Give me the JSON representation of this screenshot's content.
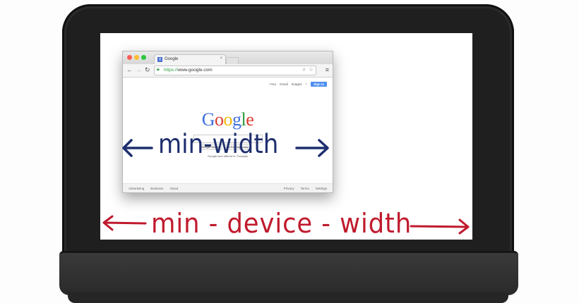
{
  "browser": {
    "tab_favicon": "g",
    "tab_title": "Google",
    "tab_close": "×",
    "url_secure": "https://",
    "url_rest": "www.google.com",
    "google_topbar": [
      "+You",
      "Gmail",
      "Images"
    ],
    "apps_icon": "apps-grid-icon",
    "sign_in": "Sign in",
    "logo_letters": [
      {
        "char": "G",
        "color": "#3c6fe0"
      },
      {
        "char": "o",
        "color": "#d93b2d"
      },
      {
        "char": "o",
        "color": "#f2b90f"
      },
      {
        "char": "g",
        "color": "#3c6fe0"
      },
      {
        "char": "l",
        "color": "#2b9c3e"
      },
      {
        "char": "e",
        "color": "#d93b2d"
      }
    ],
    "search_buttons": [
      "Google Search",
      "I'm Feeling Lucky"
    ],
    "language_line": "Google.com offered in: Français",
    "footer_left": [
      "Advertising",
      "Business",
      "About"
    ],
    "footer_right": [
      "Privacy",
      "Terms",
      "Settings"
    ]
  },
  "annotations": {
    "min_width": "min-width",
    "min_device_width": "min - device - width",
    "min_width_color": "#1d2e6e",
    "min_device_width_color": "#c01a2d"
  },
  "icons": [
    "back-arrow-icon",
    "forward-arrow-icon",
    "reload-icon",
    "lock-icon",
    "search-icon",
    "star-icon",
    "menu-icon",
    "apps-grid-icon"
  ]
}
